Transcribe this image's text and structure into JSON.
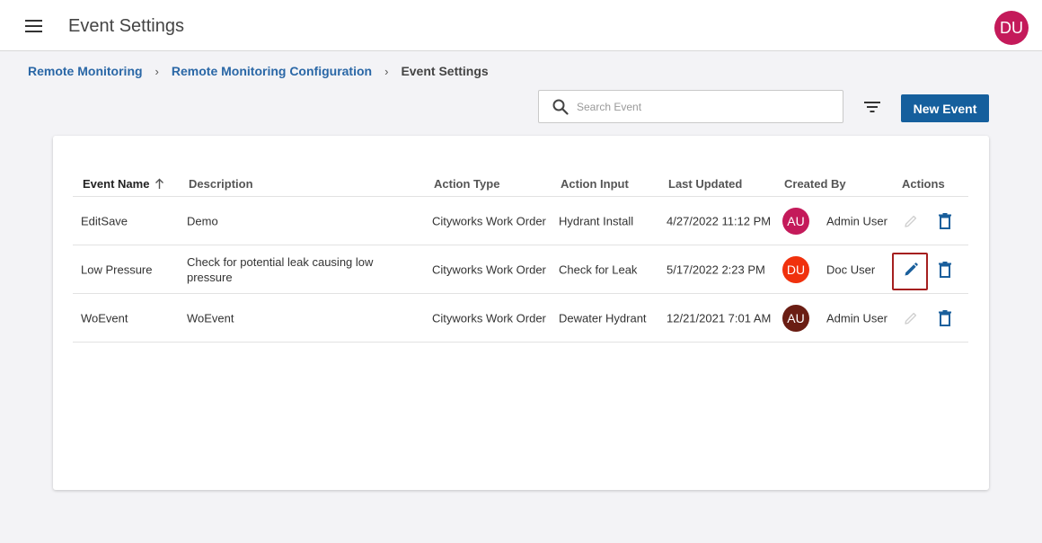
{
  "header": {
    "title": "Event Settings",
    "user_initials": "DU"
  },
  "breadcrumb": {
    "items": [
      "Remote Monitoring",
      "Remote Monitoring Configuration"
    ],
    "current": "Event Settings",
    "separator": "›"
  },
  "toolbar": {
    "search_placeholder": "Search Event",
    "search_value": "",
    "new_button_label": "New Event"
  },
  "table": {
    "columns": [
      "Event Name",
      "Description",
      "Action Type",
      "Action Input",
      "Last Updated",
      "Created By",
      "Actions"
    ],
    "sort_column": "Event Name",
    "sort_direction": "ascending",
    "rows": [
      {
        "name": "EditSave",
        "description": "Demo",
        "action_type": "Cityworks Work Order",
        "action_input": "Hydrant Install",
        "last_updated": "4/27/2022 11:12 PM",
        "creator_initials": "AU",
        "creator_name": "Admin User",
        "avatar_color": "#c41a5a",
        "edit_enabled": false
      },
      {
        "name": "Low Pressure",
        "description": "Check for potential leak causing low pressure",
        "action_type": "Cityworks Work Order",
        "action_input": "Check for Leak",
        "last_updated": "5/17/2022 2:23 PM",
        "creator_initials": "DU",
        "creator_name": "Doc User",
        "avatar_color": "#f0310d",
        "edit_enabled": true
      },
      {
        "name": "WoEvent",
        "description": "WoEvent",
        "action_type": "Cityworks Work Order",
        "action_input": "Dewater Hydrant",
        "last_updated": "12/21/2021 7:01 AM",
        "creator_initials": "AU",
        "creator_name": "Admin User",
        "avatar_color": "#6a1d13",
        "edit_enabled": false
      }
    ]
  },
  "colors": {
    "primary": "#155f9d",
    "link": "#2a67a6",
    "highlight_border": "#a51f1f",
    "page_background": "#f3f3f6"
  },
  "icons": [
    "menu-icon",
    "search-icon",
    "filter-icon",
    "sort-arrow-up-icon",
    "pencil-icon",
    "trash-icon"
  ]
}
